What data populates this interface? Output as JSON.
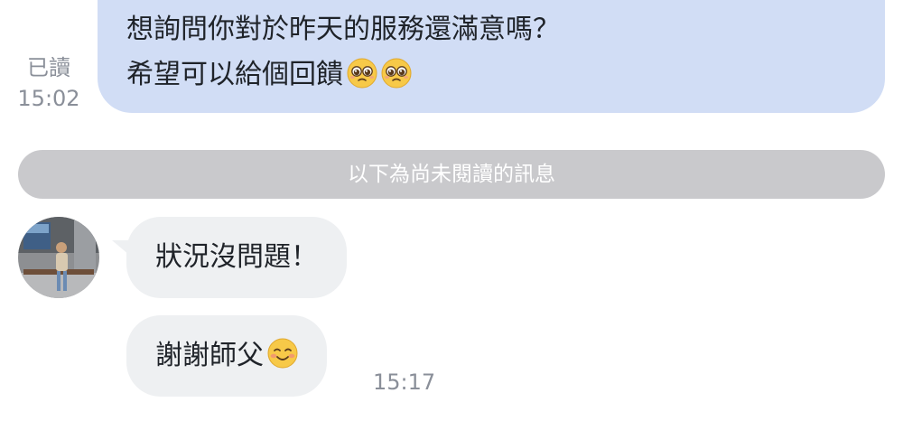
{
  "outgoing": {
    "read_label": "已讀",
    "time": "15:02",
    "line1": "想詢問你對於昨天的服務還滿意嗎？",
    "line2": "希望可以給個回饋",
    "emojis": [
      "pleading-face-emoji",
      "pleading-face-emoji"
    ]
  },
  "divider": {
    "label": "以下為尚未閱讀的訊息"
  },
  "incoming": {
    "avatar_icon": "user-avatar-photo",
    "message1": "狀況沒問題！",
    "message2": "謝謝師父",
    "message2_emoji": "smiling-blushing-face-emoji",
    "time": "15:17"
  },
  "colors": {
    "outgoing_bubble": "#d1ddf5",
    "incoming_bubble": "#eef0f2",
    "divider": "#c9c9cc",
    "meta_text": "#8a8f99"
  }
}
